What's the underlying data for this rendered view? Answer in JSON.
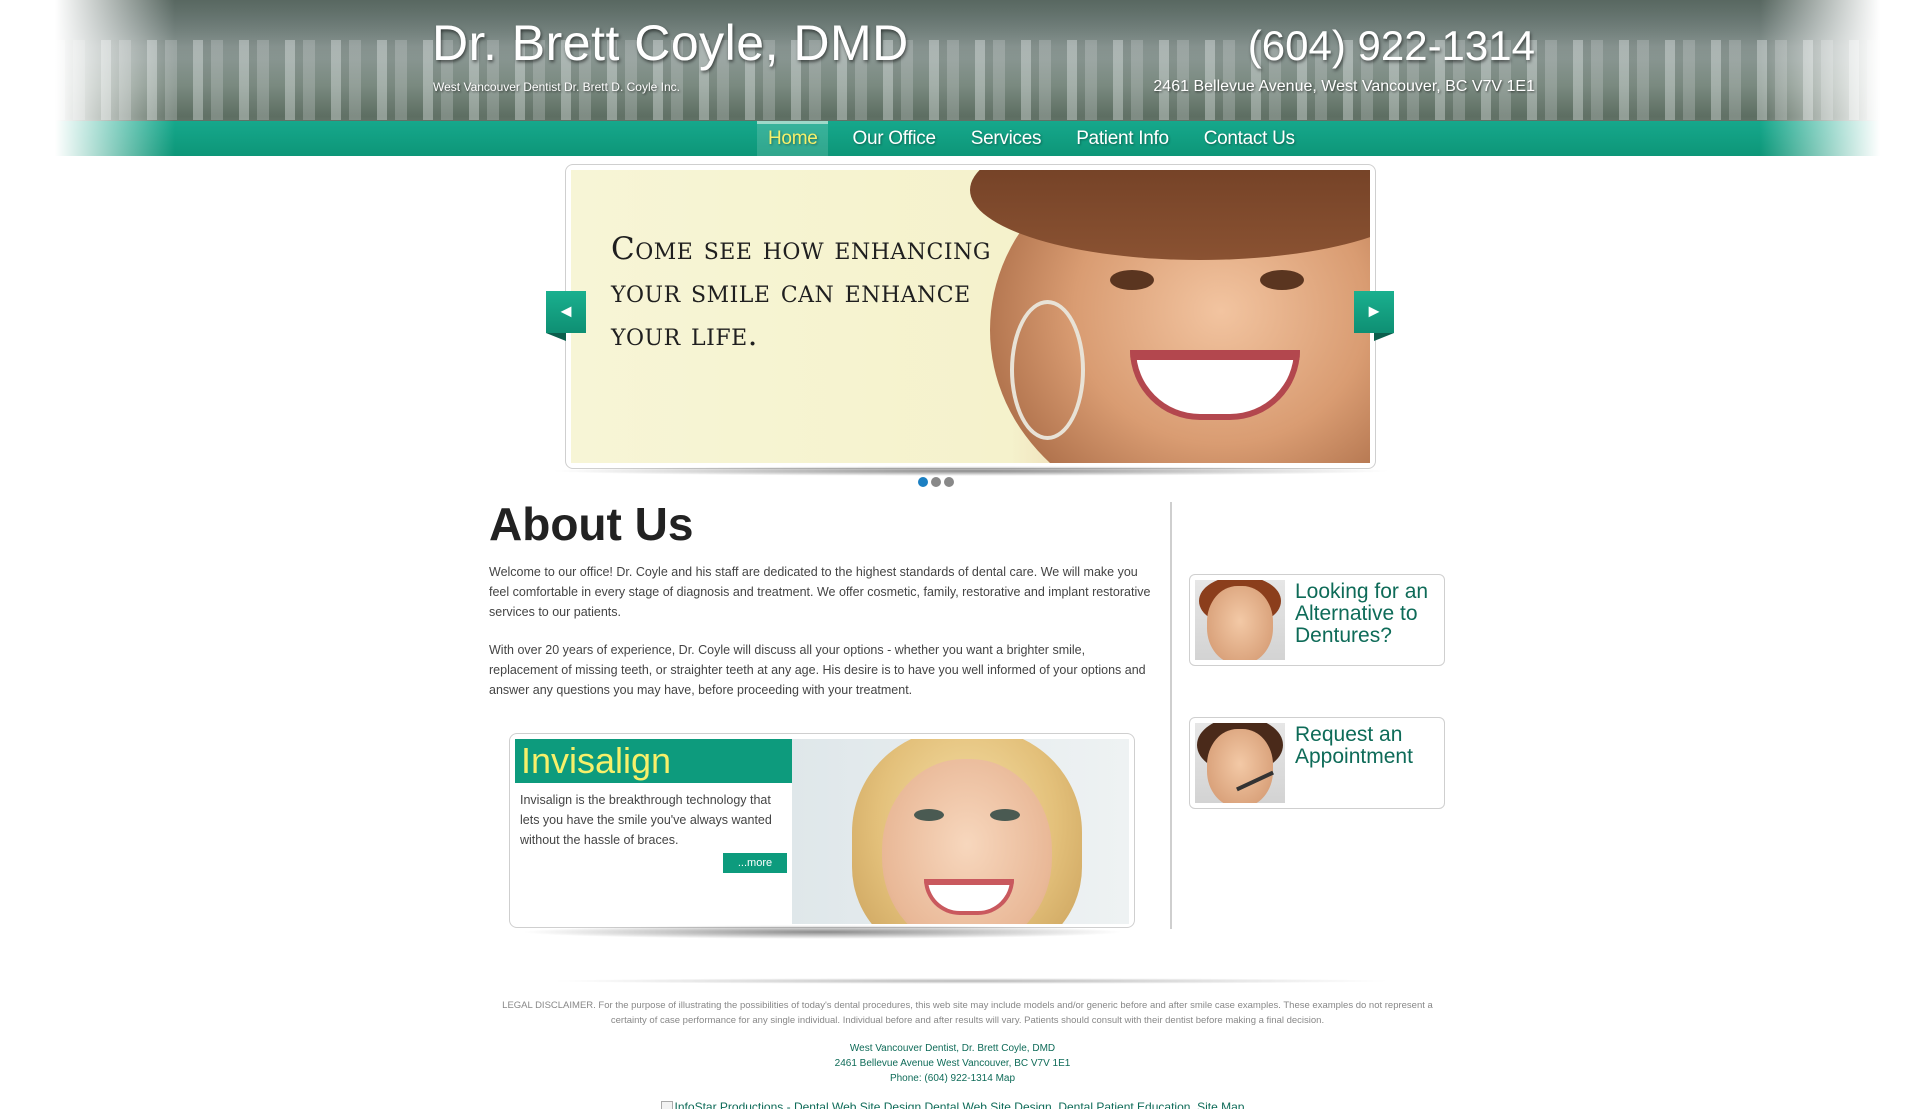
{
  "header": {
    "title": "Dr. Brett Coyle, DMD",
    "tagline": "West Vancouver Dentist Dr. Brett D. Coyle Inc.",
    "phone": "(604) 922-1314",
    "address": "2461 Bellevue Avenue, West Vancouver, BC V7V 1E1"
  },
  "nav": {
    "items": [
      {
        "label": "Home",
        "active": true
      },
      {
        "label": "Our Office"
      },
      {
        "label": "Services"
      },
      {
        "label": "Patient Info"
      },
      {
        "label": "Contact Us"
      }
    ]
  },
  "slider": {
    "text": "Come see how enhancing your smile can enhance your life.",
    "prev_label": "◄",
    "next_label": "►",
    "dots": 3,
    "active_dot": 1
  },
  "about": {
    "title": "About Us",
    "p1": "Welcome to our office! Dr. Coyle and his staff are dedicated to the highest standards of dental care. We will make you feel comfortable in every stage of diagnosis and treatment. We offer cosmetic, family, restorative and implant restorative services to our patients.",
    "p2": "With over 20 years of experience, Dr. Coyle will discuss all your options - whether you want a brighter smile, replacement of missing teeth, or straighter teeth at any age. His desire is to have you well informed of your options and answer any questions you may have, before proceeding with your treatment."
  },
  "feature": {
    "title": "Invisalign",
    "text": "Invisalign is the breakthrough technology that lets you have the smile you've always wanted without the hassle of braces.",
    "more_label": "...more"
  },
  "sidebar": {
    "card1": "Looking for an Alternative to Dentures?",
    "card2": "Request an Appointment"
  },
  "footer": {
    "disclaimer": "LEGAL DISCLAIMER. For the purpose of illustrating the possibilities of today's dental procedures, this web site may include models and/or generic before and after smile case examples. These examples do not represent a certainty of case performance for any single individual. Individual before and after results will vary. Patients should consult with their dentist before making a final decision.",
    "line1": "West Vancouver Dentist, Dr. Brett Coyle, DMD",
    "line2": "2461 Bellevue Avenue West Vancouver, BC V7V 1E1",
    "phone_prefix": "Phone: (604) 922-1314",
    "map_label": "Map",
    "infostar_alt": "InfoStar Productions - Dental Web Site Design",
    "link_design": "Dental Web Site Design",
    "link_education": "Dental Patient Education",
    "link_sitemap": "Site Map"
  },
  "colors": {
    "brand_teal": "#0d9b7d",
    "nav_active": "#f7f06a",
    "link_green": "#0e6b58",
    "dot_active": "#1b7fc2"
  }
}
